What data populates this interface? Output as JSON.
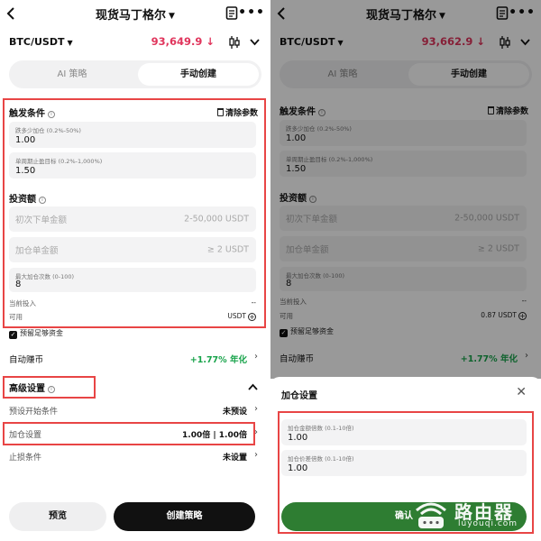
{
  "header": {
    "title": "现货马丁格尔",
    "icons": [
      "back-icon",
      "document-icon",
      "more-icon"
    ]
  },
  "left": {
    "pair": "BTC/USDT",
    "price": "93,649.9 ↓",
    "tabs": {
      "ai": "AI 策略",
      "manual": "手动创建"
    },
    "trigger": {
      "title": "触发条件",
      "clear": "清除参数",
      "field1_label": "跌多少加仓 (0.2%-50%)",
      "field1_value": "1.00",
      "field2_label": "单周期止盈目标 (0.2%-1,000%)",
      "field2_value": "1.50"
    },
    "invest": {
      "title": "投资额",
      "initial_ph": "初次下单金额",
      "initial_range": "2-50,000 USDT",
      "add_ph": "加仓单金额",
      "add_range": "≥ 2 USDT",
      "max_label": "最大加仓次数 (0-100)",
      "max_value": "8",
      "current_label": "当前投入",
      "current_value": "--",
      "avail_label": "可用",
      "avail_value": "USDT",
      "reserve": "预留足够资金"
    },
    "auto_earn": {
      "label": "自动赚币",
      "value": "+1.77% 年化"
    },
    "advanced": {
      "title": "高级设置",
      "preset_label": "预设开始条件",
      "preset_value": "未预设",
      "add_setting_label": "加仓设置",
      "add_setting_value": "1.00倍 | 1.00倍",
      "stop_label": "止损条件",
      "stop_value": "未设置"
    },
    "buttons": {
      "preview": "预览",
      "create": "创建策略"
    }
  },
  "right": {
    "pair": "BTC/USDT",
    "price": "93,662.9 ↓",
    "tabs": {
      "ai": "AI 策略",
      "manual": "手动创建"
    },
    "trigger": {
      "title": "触发条件",
      "clear": "清除参数",
      "field1_label": "跌多少加仓 (0.2%-50%)",
      "field1_value": "1.00",
      "field2_label": "单周期止盈目标 (0.2%-1,000%)",
      "field2_value": "1.50"
    },
    "invest": {
      "title": "投资额",
      "initial_ph": "初次下单金额",
      "initial_range": "2-50,000 USDT",
      "add_ph": "加仓单金额",
      "add_range": "≥ 2 USDT",
      "max_label": "最大加仓次数 (0-100)",
      "max_value": "8",
      "current_label": "当前投入",
      "current_value": "--",
      "avail_label": "可用",
      "avail_value": "0.87 USDT",
      "reserve": "预留足够资金"
    },
    "auto_earn": {
      "label": "自动赚币",
      "value": "+1.77% 年化"
    },
    "sheet": {
      "title": "加仓设置",
      "amount_label": "加仓金额倍数 (0.1-10倍)",
      "amount_value": "1.00",
      "price_label": "加仓价差倍数 (0.1-10倍)",
      "price_value": "1.00",
      "confirm": "确认"
    }
  },
  "watermark": {
    "cn": "路由器",
    "en": "luyouqi.com"
  },
  "colors": {
    "price_red": "#e0355c",
    "green": "#17a34a",
    "highlight_red": "#e84545",
    "confirm_green": "#2e7d32"
  }
}
